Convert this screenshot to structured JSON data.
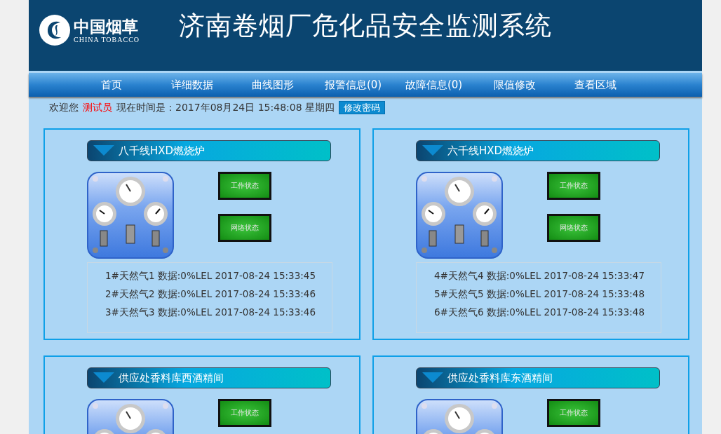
{
  "header": {
    "logo_cn": "中国烟草",
    "logo_en": "CHINA TOBACCO",
    "title": "济南卷烟厂危化品安全监测系统"
  },
  "nav": [
    "首页",
    "详细数据",
    "曲线图形",
    "报警信息(0)",
    "故障信息(0)",
    "限值修改",
    "查看区域"
  ],
  "welcome": {
    "greeting": "欢迎您",
    "user": "测试员",
    "time": "现在时间是：2017年08月24日 15:48:08 星期四",
    "button": "修改密码"
  },
  "areas": [
    {
      "title": "八千线HXD燃烧炉",
      "buttons": [
        "工作状态",
        "网络状态"
      ],
      "readings": [
        "1#天然气1 数据:0%LEL 2017-08-24 15:33:45",
        "2#天然气2 数据:0%LEL 2017-08-24 15:33:46",
        "3#天然气3 数据:0%LEL 2017-08-24 15:33:46"
      ]
    },
    {
      "title": "六千线HXD燃烧炉",
      "buttons": [
        "工作状态",
        "网络状态"
      ],
      "readings": [
        "4#天然气4 数据:0%LEL 2017-08-24 15:33:47",
        "5#天然气5 数据:0%LEL 2017-08-24 15:33:48",
        "6#天然气6 数据:0%LEL 2017-08-24 15:33:48"
      ]
    },
    {
      "title": "供应处香料库西酒精间",
      "buttons": [
        "工作状态"
      ]
    },
    {
      "title": "供应处香料库东酒精间",
      "buttons": [
        "工作状态"
      ]
    }
  ]
}
